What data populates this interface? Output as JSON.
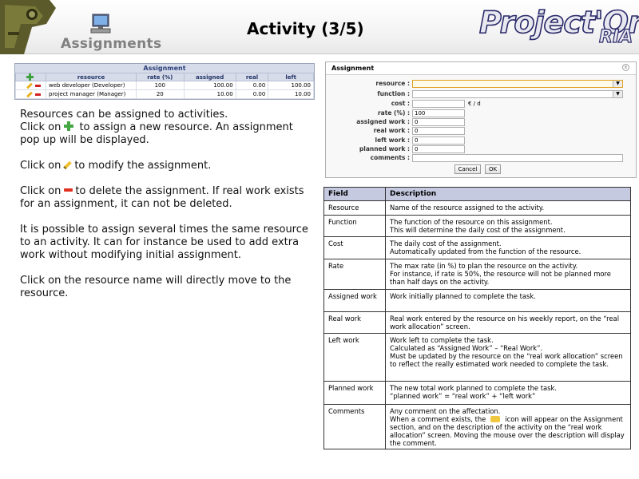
{
  "header": {
    "section_label": "Assignments",
    "title": "Activity (3/5)",
    "brand": "Project'Or",
    "brand_sub": "RIA"
  },
  "assignment_panel": {
    "title": "Assignment",
    "columns": [
      "resource",
      "rate (%)",
      "assigned",
      "real",
      "left"
    ],
    "rows": [
      {
        "resource": "web developer (Developer)",
        "rate": "100",
        "assigned": "100.00",
        "real": "0.00",
        "left": "100.00"
      },
      {
        "resource": "project manager (Manager)",
        "rate": "20",
        "assigned": "10.00",
        "real": "0.00",
        "left": "10.00"
      }
    ]
  },
  "help_text": {
    "p1a": "Resources can be assigned to activities.",
    "p1b": "Click on",
    "p1c": "to assign a new resource. An assignment pop up will be displayed.",
    "p2a": "Click on",
    "p2b": "to modify the assignment.",
    "p3a": "Click on",
    "p3b": "to delete the assignment. If real work exists for an assignment, it can not be deleted.",
    "p4": "It is possible to assign several times the same resource to an activity. It can for instance be used to add extra work without modifying initial assignment.",
    "p5": "Click on the resource name will directly move to the resource."
  },
  "dialog": {
    "title": "Assignment",
    "close": "x",
    "fields": {
      "resource": "resource :",
      "function": "function :",
      "cost": "cost :",
      "cost_unit": "€ / d",
      "rate": "rate (%) :",
      "rate_value": "100",
      "assigned": "assigned work :",
      "assigned_value": "0",
      "real": "real work :",
      "real_value": "0",
      "left": "left work :",
      "left_value": "0",
      "planned": "planned work :",
      "planned_value": "0",
      "comments": "comments :"
    },
    "cancel": "Cancel",
    "ok": "OK"
  },
  "desc_table": {
    "h_field": "Field",
    "h_desc": "Description",
    "rows": [
      {
        "field": "Resource",
        "desc": [
          "Name of the resource assigned to the activity."
        ]
      },
      {
        "field": "Function",
        "desc": [
          "The function of the resource on this assignment.",
          "This will determine the daily cost of the assignment."
        ]
      },
      {
        "field": "Cost",
        "desc": [
          "The daily cost of the assignment.",
          "Automatically updated from the function of the resource."
        ]
      },
      {
        "field": "Rate",
        "desc": [
          "The max rate (in %) to plan the resource on the activity.",
          "For instance, if rate is 50%, the resource will not be planned more than half days on the activity."
        ]
      },
      {
        "field": "Assigned work",
        "desc": [
          "Work initially planned to complete the task."
        ]
      },
      {
        "field": "Real work",
        "desc": [
          "Real work entered by the resource on his weekly report, on the “real work allocation” screen."
        ]
      },
      {
        "field": "Left work",
        "desc": [
          "Work left to complete the task.",
          "Calculated as “Assigned Work” – “Real Work”.",
          "Must be updated by the resource on the “real work allocation” screen to reflect the really estimated work needed to complete the task."
        ]
      },
      {
        "field": "Planned work",
        "desc": [
          "The new total work planned to complete the task.",
          "“planned work” = “real work” + “left work”"
        ]
      },
      {
        "field": "Comments",
        "desc": [
          "Any comment on the affectation."
        ]
      }
    ],
    "comments_p2a": "When a comment exists, the",
    "comments_p2b": "icon will appear on the Assignment section, and on the description of the activity on the “real work allocation” screen. Moving the mouse over the description will display the comment."
  }
}
